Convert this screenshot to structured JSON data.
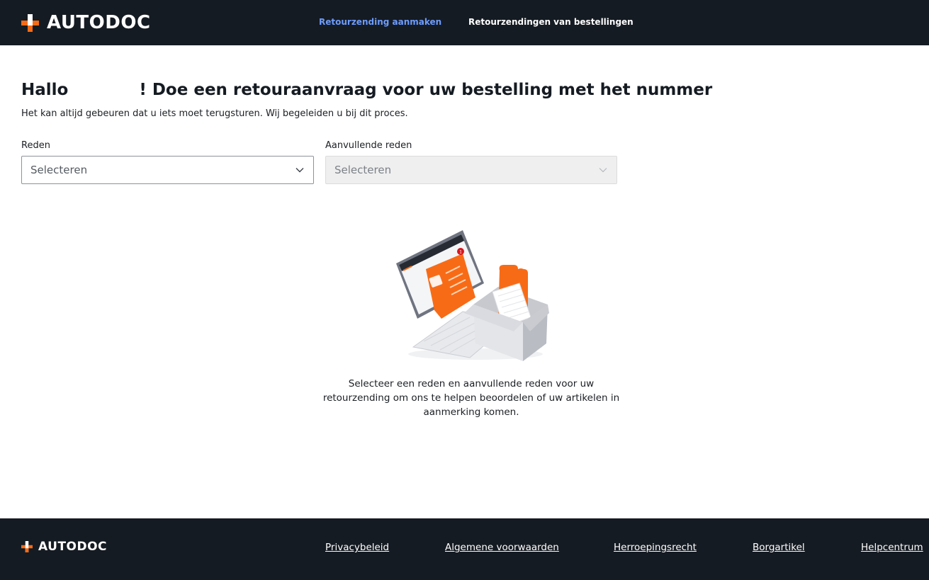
{
  "brand": {
    "name": "AUTODOC",
    "accent": "#f86b16",
    "header_bg": "#151b22"
  },
  "nav": {
    "items": [
      {
        "label": "Retourzending aanmaken",
        "active": true
      },
      {
        "label": "Retourzendingen van bestellingen",
        "active": false
      }
    ],
    "active_color": "#6d9cff"
  },
  "main": {
    "greeting": "Hallo",
    "title_rest": "! Doe een retouraanvraag voor uw bestelling met het nummer",
    "subtitle": "Het kan altijd gebeuren dat u iets moet terugsturen. Wij begeleiden u bij dit proces.",
    "reason": {
      "label": "Reden",
      "value": "Selecteren",
      "icon": "chevron-down-icon"
    },
    "additional_reason": {
      "label": "Aanvullende reden",
      "value": "Selecteren",
      "disabled": true,
      "icon": "chevron-down-icon"
    },
    "empty_state": {
      "icon": "return-parcel-illustration",
      "notification_count": "1",
      "message": "Selecteer een reden en aanvullende reden voor uw retourzending om ons te helpen beoordelen of uw artikelen in aanmerking komen."
    }
  },
  "footer": {
    "links": [
      "Privacybeleid",
      "Algemene voorwaarden",
      "Herroepingsrecht",
      "Borgartikel",
      "Helpcentrum"
    ]
  }
}
